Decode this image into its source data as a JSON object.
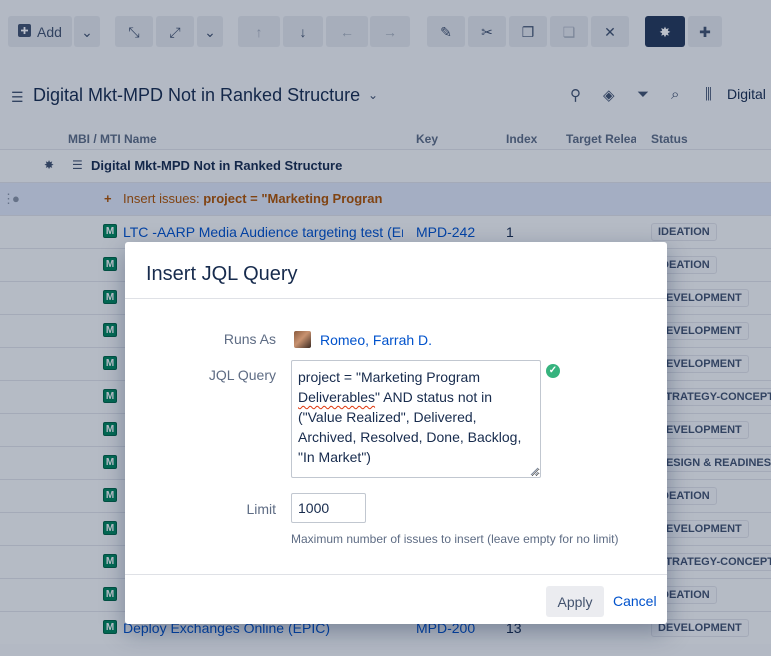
{
  "toolbar": {
    "add_label": "Add"
  },
  "structure": {
    "title": "Digital Mkt-MPD Not in Ranked Structure",
    "right_label": "Digital"
  },
  "columns": {
    "name": "MBI / MTI Name",
    "key": "Key",
    "index": "Index",
    "target_release": "Target Relea",
    "status": "Status"
  },
  "grid": {
    "root_name": "Digital Mkt-MPD Not in Ranked Structure",
    "insert_prefix": "Insert issues: ",
    "insert_query": "project = \"Marketing Progran",
    "rows": [
      {
        "badge": "M",
        "name": "LTC -AARP Media Audience targeting test (En",
        "key": "MPD-242",
        "index": "1",
        "status": "IDEATION"
      },
      {
        "badge": "M",
        "name": "",
        "key": "",
        "index": "",
        "status": "IDEATION"
      },
      {
        "badge": "M",
        "name": "",
        "key": "",
        "index": "",
        "status": "DEVELOPMENT"
      },
      {
        "badge": "M",
        "name": "",
        "key": "",
        "index": "",
        "status": "DEVELOPMENT"
      },
      {
        "badge": "M",
        "name": "",
        "key": "",
        "index": "",
        "status": "DEVELOPMENT"
      },
      {
        "badge": "M",
        "name": "",
        "key": "",
        "index": "",
        "status": "STRATEGY-CONCEPT"
      },
      {
        "badge": "M",
        "name": "",
        "key": "",
        "index": "",
        "status": "DEVELOPMENT"
      },
      {
        "badge": "M",
        "name": "",
        "key": "",
        "index": "",
        "status": "DESIGN & READINES"
      },
      {
        "badge": "M",
        "name": "",
        "key": "",
        "index": "",
        "status": "IDEATION"
      },
      {
        "badge": "M",
        "name": "",
        "key": "",
        "index": "",
        "status": "DEVELOPMENT"
      },
      {
        "badge": "M",
        "name": "",
        "key": "",
        "index": "",
        "status": "STRATEGY-CONCEPT"
      },
      {
        "badge": "M",
        "name": "",
        "key": "",
        "index": "",
        "status": "IDEATION"
      },
      {
        "badge": "M",
        "name": "Deploy Exchanges Online (EPIC)",
        "key": "MPD-200",
        "index": "13",
        "status": "DEVELOPMENT"
      }
    ]
  },
  "dialog": {
    "title": "Insert JQL Query",
    "runs_as_label": "Runs As",
    "runs_as_user": "Romeo, Farrah D.",
    "jql_label": "JQL Query",
    "jql_line1_pre": "project = \"Marketing Program ",
    "jql_squiggle": "Deliverables",
    "jql_rest": "\" AND status not in (\"Value Realized\", Delivered, Archived, Resolved, Done, Backlog, \"In Market\")",
    "limit_label": "Limit",
    "limit_value": "1000",
    "limit_help": "Maximum number of issues to insert (leave empty for no limit)",
    "apply_label": "Apply",
    "cancel_label": "Cancel"
  }
}
